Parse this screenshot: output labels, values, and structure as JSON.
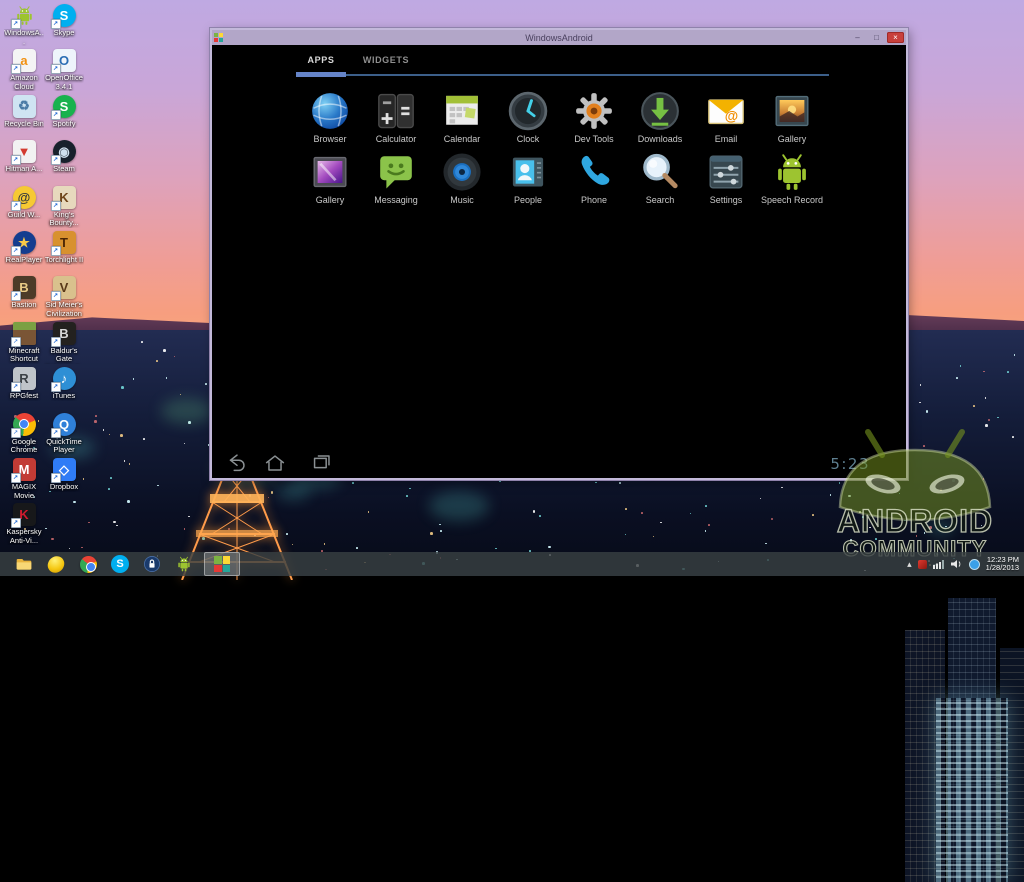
{
  "colors": {
    "titlebar": "#b2a6c8",
    "holo_blue": "#6584c8",
    "holo_line": "#3c5f8a",
    "apps_tab_text": "#d9d9d9",
    "widgets_tab_text": "#8f8f8f",
    "status_clock_color": "#5e7f90",
    "close_button": "#c8403c"
  },
  "desktop": {
    "icons": [
      {
        "label": "WindowsA...",
        "icon": "android-robot-icon",
        "type": "android"
      },
      {
        "label": "Skype",
        "icon": "skype-icon",
        "glyph": "S",
        "bg": "#00aff0",
        "fg": "#ffffff",
        "round": true
      },
      {
        "label": "Amazon Cloud Player",
        "icon": "amazon-cloud-player-icon",
        "glyph": "a",
        "bg": "#f4f4f4",
        "fg": "#f29111"
      },
      {
        "label": "OpenOffice 3.4.1",
        "icon": "openoffice-icon",
        "glyph": "O",
        "bg": "#eef4fb",
        "fg": "#2a6db4"
      },
      {
        "label": "Recycle Bin",
        "icon": "recycle-bin-icon",
        "glyph": "♻",
        "bg": "#cfe4f2",
        "fg": "#4a7ba6"
      },
      {
        "label": "Spotify",
        "icon": "spotify-icon",
        "glyph": "S",
        "bg": "#18b24e",
        "fg": "#ffffff",
        "round": true
      },
      {
        "label": "Hitman A...",
        "icon": "hitman-icon",
        "glyph": "▼",
        "bg": "#f2f2f2",
        "fg": "#d23b2f"
      },
      {
        "label": "Steam",
        "icon": "steam-icon",
        "glyph": "◉",
        "bg": "#18212c",
        "fg": "#cfe0ee",
        "round": true
      },
      {
        "label": "Guild W...",
        "icon": "guild-wars-icon",
        "glyph": "@",
        "bg": "#f6c933",
        "fg": "#35393d",
        "round": true
      },
      {
        "label": "King's Bounty...",
        "icon": "kings-bounty-icon",
        "glyph": "K",
        "bg": "#e7d9bd",
        "fg": "#6d4318"
      },
      {
        "label": "RealPlayer",
        "icon": "realplayer-icon",
        "glyph": "★",
        "bg": "#143d8f",
        "fg": "#f7c948",
        "round": true
      },
      {
        "label": "Torchlight II",
        "icon": "torchlight-icon",
        "glyph": "T",
        "bg": "#d8912f",
        "fg": "#4a2505"
      },
      {
        "label": "Bastion",
        "icon": "bastion-icon",
        "glyph": "B",
        "bg": "#4c3b28",
        "fg": "#e9cb86"
      },
      {
        "label": "Sid Meier's Civilization V",
        "icon": "civilization-icon",
        "glyph": "V",
        "bg": "#d9c18d",
        "fg": "#59391a"
      },
      {
        "label": "Minecraft Shortcut",
        "icon": "minecraft-icon",
        "type": "minecraft"
      },
      {
        "label": "Baldur's Gate Enhanced...",
        "icon": "baldurs-gate-icon",
        "glyph": "B",
        "bg": "#23211f",
        "fg": "#d8d8d8"
      },
      {
        "label": "RPGfest",
        "icon": "rpgfest-icon",
        "glyph": "R",
        "bg": "#bfc4c9",
        "fg": "#3c4146"
      },
      {
        "label": "iTunes",
        "icon": "itunes-icon",
        "glyph": "♪",
        "bg": "#2e8fd5",
        "fg": "#ffffff",
        "round": true
      },
      {
        "label": "Google Chrome",
        "icon": "chrome-icon",
        "type": "chrome"
      },
      {
        "label": "QuickTime Player",
        "icon": "quicktime-icon",
        "glyph": "Q",
        "bg": "#2f80d9",
        "fg": "#ffffff",
        "round": true
      },
      {
        "label": "MAGIX Movie Edit...",
        "icon": "magix-icon",
        "glyph": "M",
        "bg": "#c23b35",
        "fg": "#ffffff"
      },
      {
        "label": "Dropbox",
        "icon": "dropbox-icon",
        "glyph": "◇",
        "bg": "#2f7cf6",
        "fg": "#ffffff"
      },
      {
        "label": "Kaspersky Anti-Vi...",
        "icon": "kaspersky-icon",
        "glyph": "K",
        "bg": "#17181a",
        "fg": "#d01a2e"
      }
    ]
  },
  "window": {
    "title": "WindowsAndroid",
    "controls": [
      {
        "name": "minimize",
        "glyph": "–"
      },
      {
        "name": "maximize",
        "glyph": "□"
      },
      {
        "name": "close",
        "glyph": "×"
      }
    ],
    "tabs": [
      {
        "label": "APPS",
        "active": true
      },
      {
        "label": "WIDGETS",
        "active": false
      }
    ],
    "apps": [
      {
        "label": "Browser",
        "icon": "browser-icon"
      },
      {
        "label": "Calculator",
        "icon": "calculator-icon"
      },
      {
        "label": "Calendar",
        "icon": "calendar-icon"
      },
      {
        "label": "Clock",
        "icon": "clock-icon"
      },
      {
        "label": "Dev Tools",
        "icon": "dev-tools-icon"
      },
      {
        "label": "Downloads",
        "icon": "downloads-icon"
      },
      {
        "label": "Email",
        "icon": "email-icon"
      },
      {
        "label": "Gallery",
        "icon": "gallery-sunset-icon"
      },
      {
        "label": "Gallery",
        "icon": "gallery-purple-icon"
      },
      {
        "label": "Messaging",
        "icon": "messaging-icon"
      },
      {
        "label": "Music",
        "icon": "music-icon"
      },
      {
        "label": "People",
        "icon": "people-icon"
      },
      {
        "label": "Phone",
        "icon": "phone-icon"
      },
      {
        "label": "Search",
        "icon": "search-icon"
      },
      {
        "label": "Settings",
        "icon": "settings-icon"
      },
      {
        "label": "Speech Record",
        "icon": "speech-record-icon"
      }
    ],
    "navigation": [
      {
        "name": "back"
      },
      {
        "name": "home"
      },
      {
        "name": "recents"
      }
    ],
    "status_clock": "5:23"
  },
  "watermark": {
    "line1": "ANDROID",
    "line2": "COMMUNITY"
  },
  "taskbar": {
    "items": [
      {
        "name": "file-explorer",
        "icon": "folder-icon"
      },
      {
        "name": "lemon-app",
        "icon": "lemon-icon"
      },
      {
        "name": "google-chrome",
        "icon": "chrome-icon"
      },
      {
        "name": "skype",
        "icon": "skype-icon"
      },
      {
        "name": "keepass",
        "icon": "keepass-lock-icon"
      },
      {
        "name": "android-app",
        "icon": "android-robot-icon"
      },
      {
        "name": "windowsandroid",
        "icon": "windowsandroid-icon",
        "active": true
      }
    ],
    "tray": {
      "icons": [
        {
          "name": "hidden-icons"
        },
        {
          "name": "kaspersky-tray"
        },
        {
          "name": "network"
        },
        {
          "name": "volume"
        },
        {
          "name": "messenger-tray"
        }
      ],
      "time": "12:23 PM",
      "date": "1/28/2013"
    }
  }
}
